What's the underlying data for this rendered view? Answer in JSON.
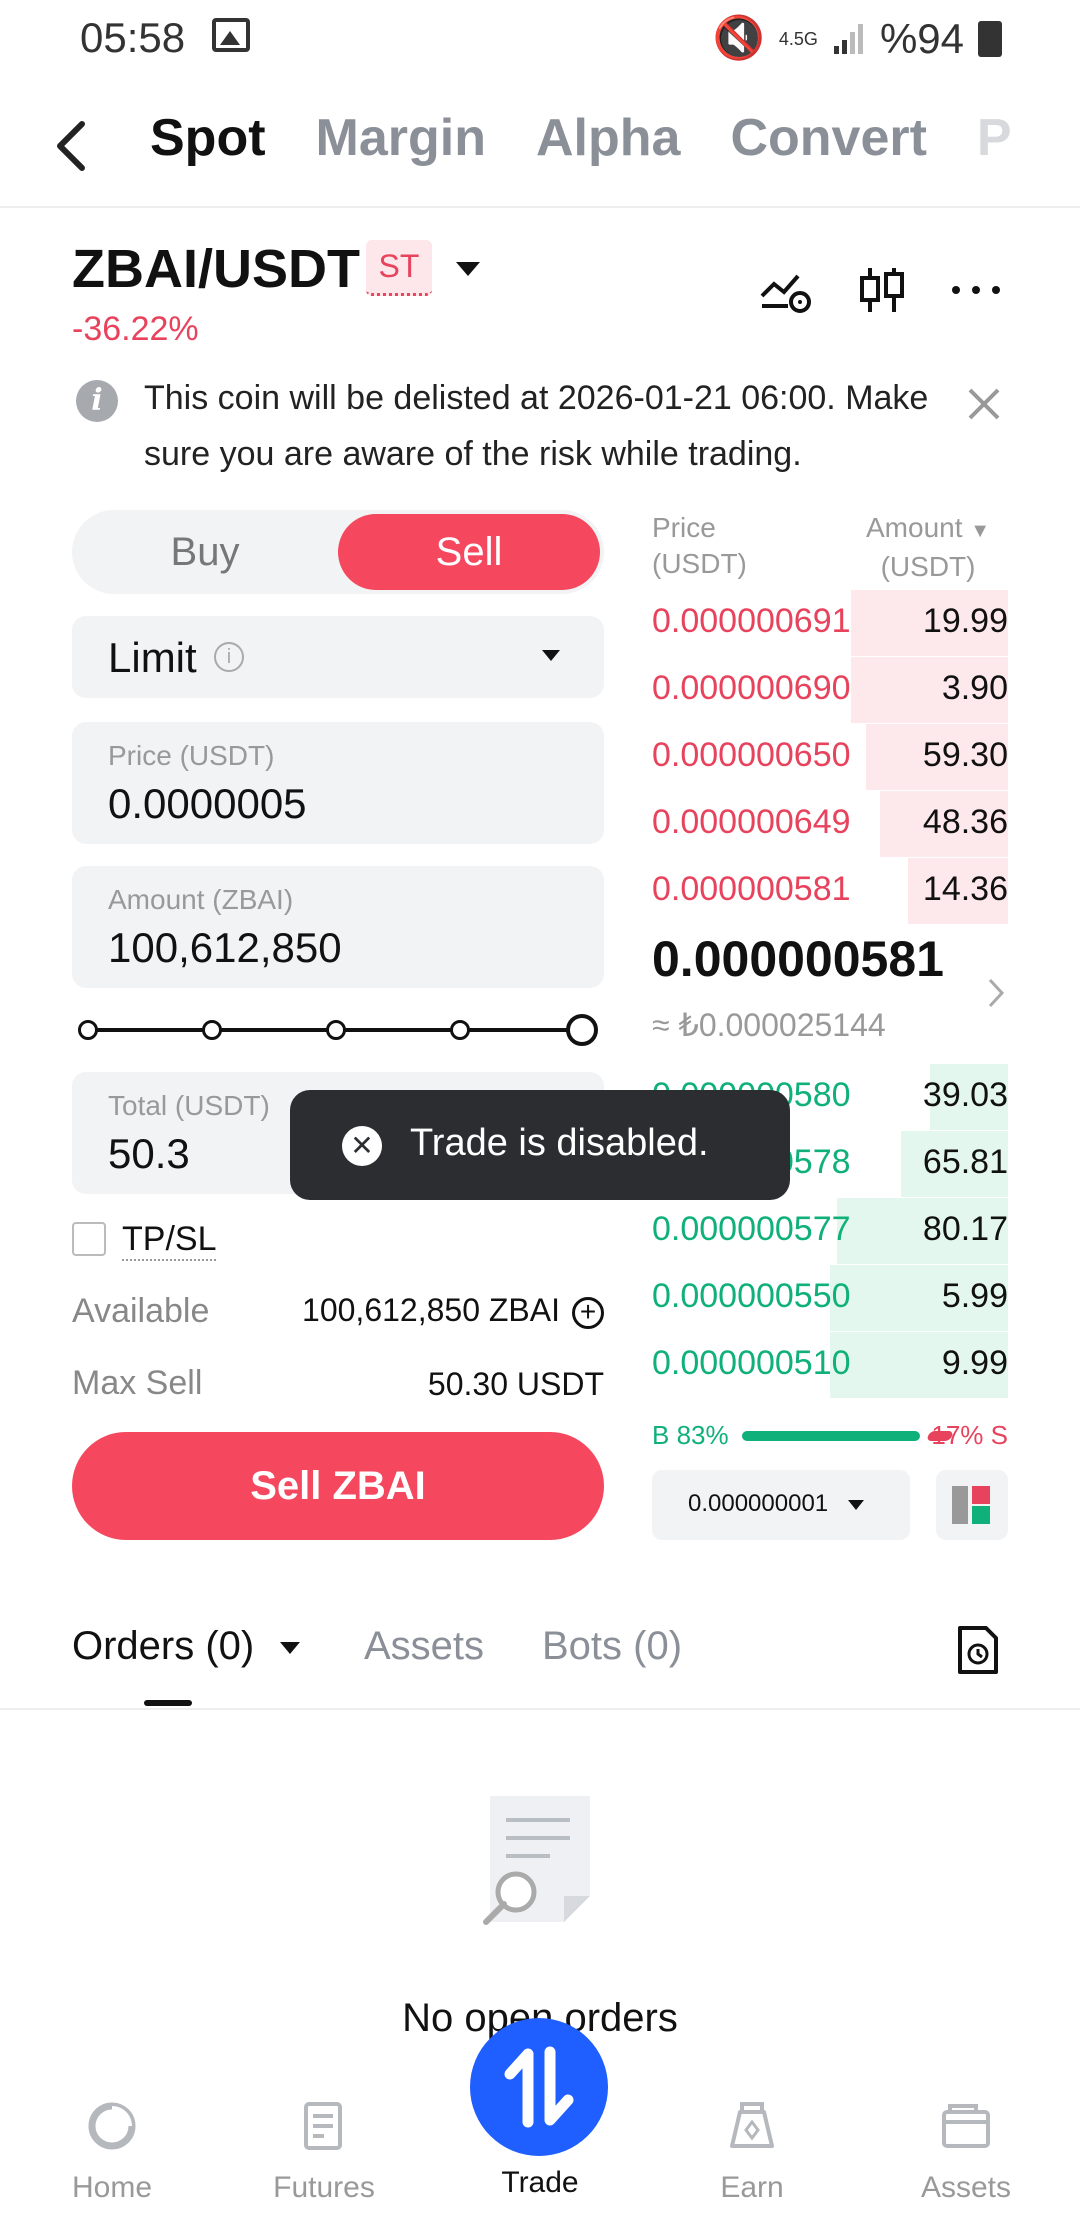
{
  "status_bar": {
    "time": "05:58",
    "network": "4.5G",
    "battery": "%94"
  },
  "top_tabs": [
    "Spot",
    "Margin",
    "Alpha",
    "Convert",
    "P"
  ],
  "pair": {
    "symbol": "ZBAI/USDT",
    "badge": "ST",
    "change": "-36.22%"
  },
  "notice": {
    "text": "This coin will be delisted at 2026-01-21 06:00. Make sure you are aware of the risk while trading."
  },
  "side_toggle": {
    "buy": "Buy",
    "sell": "Sell",
    "selected": "Sell"
  },
  "order_type": "Limit",
  "price_field": {
    "label": "Price (USDT)",
    "value": "0.0000005"
  },
  "amount_field": {
    "label": "Amount (ZBAI)",
    "value": "100,612,850"
  },
  "slider": {
    "value_percent": 100
  },
  "total_field": {
    "label": "Total (USDT)",
    "value": "50.3"
  },
  "tpsl": {
    "label": "TP/SL",
    "checked": false
  },
  "available": {
    "label": "Available",
    "value": "100,612,850 ZBAI"
  },
  "max_sell": {
    "label": "Max Sell",
    "value": "50.30 USDT"
  },
  "sell_button": "Sell ZBAI",
  "orderbook": {
    "price_header": [
      "Price",
      "(USDT)"
    ],
    "amount_header": [
      "Amount",
      "(USDT)"
    ],
    "asks": [
      {
        "price": "0.000000691",
        "amount": "19.99",
        "depth": 0.44
      },
      {
        "price": "0.000000690",
        "amount": "3.90",
        "depth": 0.44
      },
      {
        "price": "0.000000650",
        "amount": "59.30",
        "depth": 0.4
      },
      {
        "price": "0.000000649",
        "amount": "48.36",
        "depth": 0.36
      },
      {
        "price": "0.000000581",
        "amount": "14.36",
        "depth": 0.28
      }
    ],
    "last_price": "0.000000581",
    "last_fiat": "≈ ₺0.000025144",
    "bids": [
      {
        "price": "0.000000580",
        "amount": "39.03",
        "depth": 0.22
      },
      {
        "price": "0.000000578",
        "amount": "65.81",
        "depth": 0.3
      },
      {
        "price": "0.000000577",
        "amount": "80.17",
        "depth": 0.48
      },
      {
        "price": "0.000000550",
        "amount": "5.99",
        "depth": 0.5
      },
      {
        "price": "0.000000510",
        "amount": "9.99",
        "depth": 0.5
      }
    ],
    "buy_ratio": "B 83%",
    "sell_ratio": "17% S",
    "precision": "0.000000001"
  },
  "toast": "Trade is disabled.",
  "orders_tabs": [
    "Orders (0)",
    "Assets",
    "Bots (0)"
  ],
  "empty_orders": "No open orders",
  "bottom_nav": [
    "Home",
    "Futures",
    "Trade",
    "Earn",
    "Assets"
  ],
  "colors": {
    "sell": "#f5475e",
    "buy": "#10b07a",
    "fab": "#1f5eff"
  }
}
